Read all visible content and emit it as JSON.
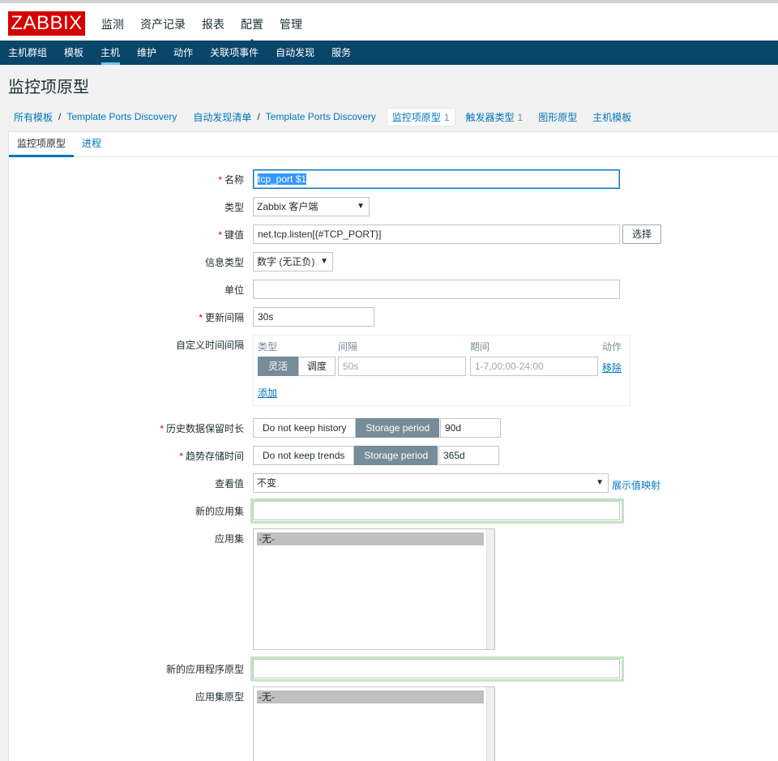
{
  "logo": "ZABBIX",
  "topnav": [
    "监测",
    "资产记录",
    "报表",
    "配置",
    "管理"
  ],
  "subnav": [
    "主机群组",
    "模板",
    "主机",
    "维护",
    "动作",
    "关联项事件",
    "自动发现",
    "服务"
  ],
  "page_title": "监控项原型",
  "breadcrumb": {
    "all_templates": "所有模板",
    "sep": "/",
    "template1": "Template Ports Discovery",
    "discovery_list": "自动发现清单",
    "template2": "Template Ports Discovery",
    "item_prototypes": "监控项原型",
    "item_prototypes_count": "1",
    "trigger_types": "触发器类型",
    "trigger_types_count": "1",
    "graph_prototypes": "图形原型",
    "host_templates": "主机模板"
  },
  "tabs": [
    "监控项原型",
    "进程"
  ],
  "form": {
    "name_label": "名称",
    "name_value": "tcp_port $1",
    "type_label": "类型",
    "type_value": "Zabbix 客户端",
    "key_label": "键值",
    "key_value": "net.tcp.listen[{#TCP_PORT}]",
    "select_button": "选择",
    "info_type_label": "信息类型",
    "info_type_value": "数字 (无正负)",
    "units_label": "单位",
    "units_value": "",
    "interval_label": "更新间隔",
    "interval_value": "30s",
    "custom_intervals_label": "自定义时间间隔",
    "custom": {
      "col_type": "类型",
      "col_interval": "间隔",
      "col_period": "期间",
      "col_action": "动作",
      "flexible": "灵活",
      "scheduling": "调度",
      "interval_placeholder": "50s",
      "period_placeholder": "1-7,00:00-24:00",
      "remove": "移除",
      "add": "添加"
    },
    "history_label": "历史数据保留时长",
    "history_no_keep": "Do not keep history",
    "history_storage": "Storage period",
    "history_value": "90d",
    "trends_label": "趋势存储时间",
    "trends_no_keep": "Do not keep trends",
    "trends_storage": "Storage period",
    "trends_value": "365d",
    "show_value_label": "查看值",
    "show_value_value": "不变",
    "show_value_mapping": "展示值映射",
    "new_app_label": "新的应用集",
    "new_app_value": "",
    "apps_label": "应用集",
    "apps_option": "-无-",
    "new_app_proto_label": "新的应用程序原型",
    "new_app_proto_value": "",
    "app_protos_label": "应用集原型",
    "app_protos_option": "-无-"
  },
  "colors": {
    "brand_red": "#d40000",
    "nav_blue": "#0a466a",
    "link_blue": "#0275b8",
    "segment_active": "#768d99"
  }
}
